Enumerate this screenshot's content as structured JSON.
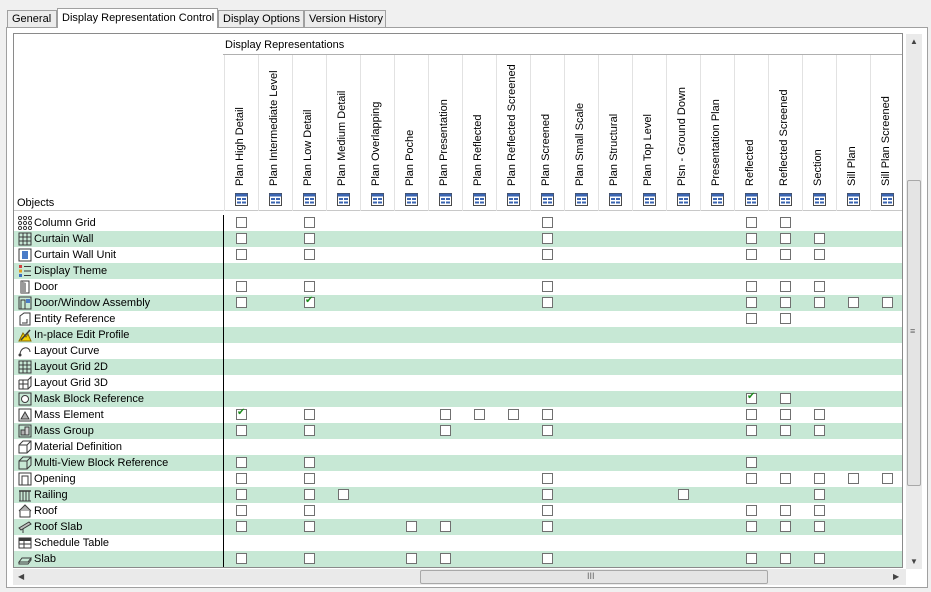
{
  "tabs": [
    {
      "label": "General"
    },
    {
      "label": "Display Representation Control"
    },
    {
      "label": "Display Options"
    },
    {
      "label": "Version History"
    }
  ],
  "header": {
    "group_label": "Display Representations",
    "objects_label": "Objects"
  },
  "columns": [
    "Plan High Detail",
    "Plan Intermediate Level",
    "Plan Low Detail",
    "Plan Medium Detail",
    "Plan Overlapping",
    "Plan Poche",
    "Plan Presentation",
    "Plan Reflected",
    "Plan Reflected Screened",
    "Plan Screened",
    "Plan Small Scale",
    "Plan Structural",
    "Plan Top Level",
    "Plsn - Ground Down",
    "Presentation Plan",
    "Reflected",
    "Reflected Screened",
    "Section",
    "Sill Plan",
    "Sill Plan Screened"
  ],
  "rows": [
    {
      "name": "Column Grid",
      "icon": "column-grid-icon",
      "cells": [
        1,
        0,
        1,
        0,
        0,
        0,
        0,
        0,
        0,
        1,
        0,
        0,
        0,
        0,
        0,
        1,
        1,
        0,
        0,
        0
      ]
    },
    {
      "name": "Curtain Wall",
      "icon": "curtain-wall-icon",
      "cells": [
        1,
        0,
        1,
        0,
        0,
        0,
        0,
        0,
        0,
        1,
        0,
        0,
        0,
        0,
        0,
        1,
        1,
        1,
        0,
        0
      ]
    },
    {
      "name": "Curtain Wall Unit",
      "icon": "curtain-wall-unit-icon",
      "cells": [
        1,
        0,
        1,
        0,
        0,
        0,
        0,
        0,
        0,
        1,
        0,
        0,
        0,
        0,
        0,
        1,
        1,
        1,
        0,
        0
      ]
    },
    {
      "name": "Display Theme",
      "icon": "display-theme-icon",
      "cells": [
        0,
        0,
        0,
        0,
        0,
        0,
        0,
        0,
        0,
        0,
        0,
        0,
        0,
        0,
        0,
        0,
        0,
        0,
        0,
        0
      ]
    },
    {
      "name": "Door",
      "icon": "door-icon",
      "cells": [
        1,
        0,
        1,
        0,
        0,
        0,
        0,
        0,
        0,
        1,
        0,
        0,
        0,
        0,
        0,
        1,
        1,
        1,
        0,
        0
      ]
    },
    {
      "name": "Door/Window Assembly",
      "icon": "door-window-assembly-icon",
      "cells": [
        1,
        0,
        2,
        0,
        0,
        0,
        0,
        0,
        0,
        1,
        0,
        0,
        0,
        0,
        0,
        1,
        1,
        1,
        1,
        1
      ]
    },
    {
      "name": "Entity Reference",
      "icon": "entity-reference-icon",
      "cells": [
        0,
        0,
        0,
        0,
        0,
        0,
        0,
        0,
        0,
        0,
        0,
        0,
        0,
        0,
        0,
        1,
        1,
        0,
        0,
        0
      ]
    },
    {
      "name": "In-place Edit Profile",
      "icon": "in-place-edit-profile-icon",
      "cells": [
        0,
        0,
        0,
        0,
        0,
        0,
        0,
        0,
        0,
        0,
        0,
        0,
        0,
        0,
        0,
        0,
        0,
        0,
        0,
        0
      ]
    },
    {
      "name": "Layout Curve",
      "icon": "layout-curve-icon",
      "cells": [
        0,
        0,
        0,
        0,
        0,
        0,
        0,
        0,
        0,
        0,
        0,
        0,
        0,
        0,
        0,
        0,
        0,
        0,
        0,
        0
      ]
    },
    {
      "name": "Layout Grid 2D",
      "icon": "layout-grid-2d-icon",
      "cells": [
        0,
        0,
        0,
        0,
        0,
        0,
        0,
        0,
        0,
        0,
        0,
        0,
        0,
        0,
        0,
        0,
        0,
        0,
        0,
        0
      ]
    },
    {
      "name": "Layout Grid 3D",
      "icon": "layout-grid-3d-icon",
      "cells": [
        0,
        0,
        0,
        0,
        0,
        0,
        0,
        0,
        0,
        0,
        0,
        0,
        0,
        0,
        0,
        0,
        0,
        0,
        0,
        0
      ]
    },
    {
      "name": "Mask Block Reference",
      "icon": "mask-block-reference-icon",
      "cells": [
        0,
        0,
        0,
        0,
        0,
        0,
        0,
        0,
        0,
        0,
        0,
        0,
        0,
        0,
        0,
        2,
        1,
        0,
        0,
        0
      ]
    },
    {
      "name": "Mass Element",
      "icon": "mass-element-icon",
      "cells": [
        2,
        0,
        1,
        0,
        0,
        0,
        1,
        1,
        1,
        1,
        0,
        0,
        0,
        0,
        0,
        1,
        1,
        1,
        0,
        0
      ]
    },
    {
      "name": "Mass Group",
      "icon": "mass-group-icon",
      "cells": [
        1,
        0,
        1,
        0,
        0,
        0,
        1,
        0,
        0,
        1,
        0,
        0,
        0,
        0,
        0,
        1,
        1,
        1,
        0,
        0
      ]
    },
    {
      "name": "Material Definition",
      "icon": "material-definition-icon",
      "cells": [
        0,
        0,
        0,
        0,
        0,
        0,
        0,
        0,
        0,
        0,
        0,
        0,
        0,
        0,
        0,
        0,
        0,
        0,
        0,
        0
      ]
    },
    {
      "name": "Multi-View Block Reference",
      "icon": "multi-view-block-reference-icon",
      "cells": [
        1,
        0,
        1,
        0,
        0,
        0,
        0,
        0,
        0,
        0,
        0,
        0,
        0,
        0,
        0,
        1,
        0,
        0,
        0,
        0
      ]
    },
    {
      "name": "Opening",
      "icon": "opening-icon",
      "cells": [
        1,
        0,
        1,
        0,
        0,
        0,
        0,
        0,
        0,
        1,
        0,
        0,
        0,
        0,
        0,
        1,
        1,
        1,
        1,
        1
      ]
    },
    {
      "name": "Railing",
      "icon": "railing-icon",
      "cells": [
        1,
        0,
        1,
        1,
        0,
        0,
        0,
        0,
        0,
        1,
        0,
        0,
        0,
        1,
        0,
        0,
        0,
        1,
        0,
        0
      ]
    },
    {
      "name": "Roof",
      "icon": "roof-icon",
      "cells": [
        1,
        0,
        1,
        0,
        0,
        0,
        0,
        0,
        0,
        1,
        0,
        0,
        0,
        0,
        0,
        1,
        1,
        1,
        0,
        0
      ]
    },
    {
      "name": "Roof Slab",
      "icon": "roof-slab-icon",
      "cells": [
        1,
        0,
        1,
        0,
        0,
        1,
        1,
        0,
        0,
        1,
        0,
        0,
        0,
        0,
        0,
        1,
        1,
        1,
        0,
        0
      ]
    },
    {
      "name": "Schedule Table",
      "icon": "schedule-table-icon",
      "cells": [
        0,
        0,
        0,
        0,
        0,
        0,
        0,
        0,
        0,
        0,
        0,
        0,
        0,
        0,
        0,
        0,
        0,
        0,
        0,
        0
      ]
    },
    {
      "name": "Slab",
      "icon": "slab-icon",
      "cells": [
        1,
        0,
        1,
        0,
        0,
        1,
        1,
        0,
        0,
        1,
        0,
        0,
        0,
        0,
        0,
        1,
        1,
        1,
        0,
        0
      ]
    }
  ],
  "scrollbar": {
    "grip": "III"
  }
}
